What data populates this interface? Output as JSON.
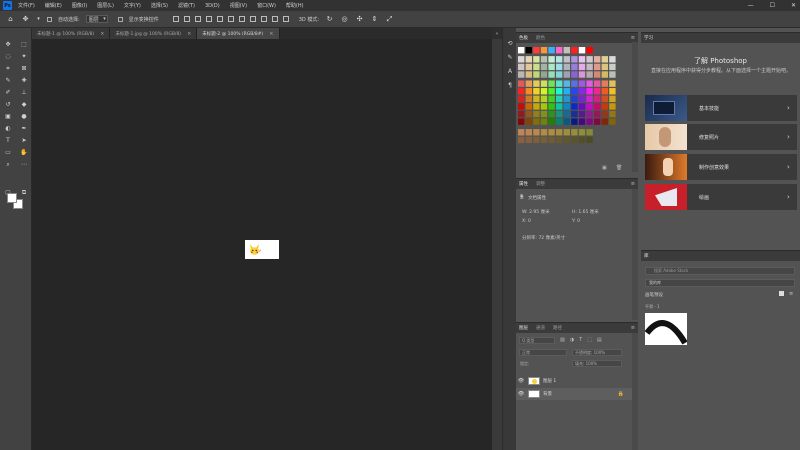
{
  "menubar": {
    "logo": "Ps",
    "items": [
      "文件(F)",
      "编辑(E)",
      "图像(I)",
      "图层(L)",
      "文字(Y)",
      "选择(S)",
      "滤镜(T)",
      "3D(D)",
      "视图(V)",
      "窗口(W)",
      "帮助(H)"
    ],
    "min": "—",
    "max": "☐",
    "close": "✕"
  },
  "options": {
    "auto_select_label": "自动选择:",
    "auto_select_value": "图层",
    "transform_label": "显示变换控件",
    "three_d_label": "3D 模式:"
  },
  "tabs": [
    {
      "label": "未标题-1 @ 100% (RGB/8)",
      "close": "×"
    },
    {
      "label": "未标题-1.jpg @ 100% (RGB/8)",
      "close": "×"
    },
    {
      "label": "未标题-2 @ 100% (RGB/8#)",
      "close": "×"
    }
  ],
  "swatches_panel": {
    "tabs": [
      "色板",
      "颜色"
    ],
    "menu": "≡"
  },
  "properties_panel": {
    "tabs": [
      "属性",
      "调整"
    ],
    "doc_label": "文档属性",
    "w_label": "W: 2.95 厘米",
    "h_label": "H: 1.65 厘米",
    "x_label": "X: 0",
    "y_label": "Y: 0",
    "res_label": "分辨率: 72 像素/英寸",
    "menu": "≡"
  },
  "layers_panel": {
    "tabs": [
      "图层",
      "通道",
      "路径"
    ],
    "kind_label": "Q 类型",
    "mode_label": "正常",
    "opacity_label": "不透明度: 100%",
    "lock_label": "锁定:",
    "fill_label": "填充: 100%",
    "layers": [
      {
        "name": "图层 1",
        "eye": "👁",
        "lock": ""
      },
      {
        "name": "背景",
        "eye": "👁",
        "lock": "🔒"
      }
    ],
    "menu": "≡"
  },
  "learn_panel": {
    "tab": "学习",
    "title": "了解 Photoshop",
    "desc": "直接在应用程序中获得分步教程。从下面选择一个主题开始吧。",
    "cards": [
      {
        "label": "基本技能",
        "chev": "›"
      },
      {
        "label": "修复照片",
        "chev": "›"
      },
      {
        "label": "制作创意效果",
        "chev": "›"
      },
      {
        "label": "绘画",
        "chev": "›"
      }
    ]
  },
  "libs_panel": {
    "tab": "库",
    "search_placeholder": "搜索 Adobe Stock",
    "lib_select": "我的库",
    "group_label": "画笔预设",
    "item_label": "平滑 - 1"
  },
  "colors": {
    "accent": "#1473e6",
    "canvas": "#262626",
    "panel": "#535353"
  }
}
